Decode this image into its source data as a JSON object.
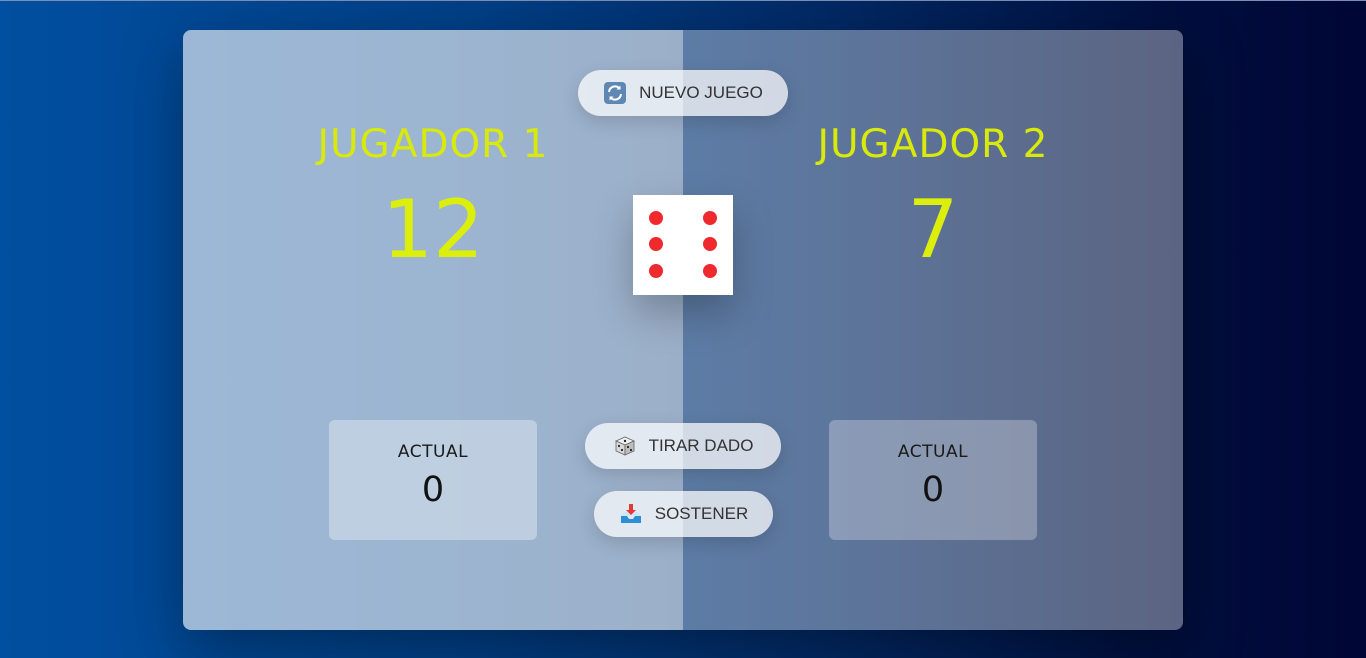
{
  "players": [
    {
      "name": "JUGADOR 1",
      "score": "12",
      "current_label": "ACTUAL",
      "current": "0"
    },
    {
      "name": "JUGADOR 2",
      "score": "7",
      "current_label": "ACTUAL",
      "current": "0"
    }
  ],
  "controls": {
    "new_game": "NUEVO JUEGO",
    "roll_dice": "TIRAR DADO",
    "hold": "SOSTENER"
  },
  "dice": {
    "value": 6,
    "pip_color": "#ee2a2f"
  },
  "colors": {
    "accent": "#d9ea0a"
  }
}
